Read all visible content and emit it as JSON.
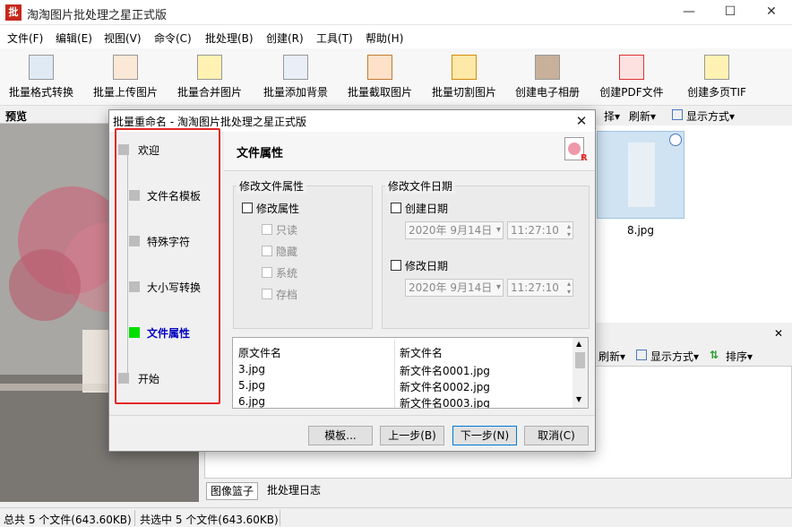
{
  "app": {
    "logo_text": "批",
    "title": "淘淘图片批处理之星正式版",
    "minimize": "—",
    "maximize": "☐",
    "close": "✕"
  },
  "menu": [
    "文件(F)",
    "编辑(E)",
    "视图(V)",
    "命令(C)",
    "批处理(B)",
    "创建(R)",
    "工具(T)",
    "帮助(H)"
  ],
  "toolbar": [
    {
      "label": "批量格式转换",
      "icon": "format-convert-icon"
    },
    {
      "label": "批量上传图片",
      "icon": "upload-icon"
    },
    {
      "label": "批量合并图片",
      "icon": "merge-icon"
    },
    {
      "label": "批量添加背景",
      "icon": "add-background-icon"
    },
    {
      "label": "批量截取图片",
      "icon": "crop-icon"
    },
    {
      "label": "批量切割图片",
      "icon": "split-icon"
    },
    {
      "label": "创建电子相册",
      "icon": "album-icon"
    },
    {
      "label": "创建PDF文件",
      "icon": "pdf-icon"
    },
    {
      "label": "创建多页TIF",
      "icon": "tif-icon"
    }
  ],
  "preview": {
    "label": "预览"
  },
  "right_toolbar": {
    "select_suffix": "择▾",
    "refresh": "刷新▾",
    "display": "显示方式▾"
  },
  "thumbnail": {
    "filename": "8.jpg"
  },
  "right_toolbar2": {
    "refresh": "刷新▾",
    "display": "显示方式▾",
    "sort": "排序▾"
  },
  "bottom_tabs": [
    "图像篮子",
    "批处理日志"
  ],
  "status": {
    "total": "总共 5 个文件(643.60KB)",
    "selected": "共选中 5 个文件(643.60KB)"
  },
  "dialog": {
    "title": "批量重命名 - 淘淘图片批处理之星正式版",
    "close": "✕",
    "steps": [
      "欢迎",
      "文件名模板",
      "特殊字符",
      "大小写转换",
      "文件属性",
      "开始"
    ],
    "active_step": 4,
    "content_title": "文件属性",
    "attr_group": {
      "title": "修改文件属性",
      "modify_label": "修改属性",
      "options": [
        "只读",
        "隐藏",
        "系统",
        "存档"
      ]
    },
    "date_group": {
      "title": "修改文件日期",
      "created_label": "创建日期",
      "created_date": "2020年  9月14日",
      "created_time": "11:27:10",
      "modified_label": "修改日期",
      "modified_date": "2020年  9月14日",
      "modified_time": "11:27:10"
    },
    "list": {
      "col_original": "原文件名",
      "col_new": "新文件名",
      "rows": [
        {
          "original": "3.jpg",
          "new": "新文件名0001.jpg"
        },
        {
          "original": "5.jpg",
          "new": "新文件名0002.jpg"
        },
        {
          "original": "6.jpg",
          "new": "新文件名0003.jpg"
        }
      ]
    },
    "buttons": {
      "template": "模板...",
      "prev": "上一步(B)",
      "next": "下一步(N)",
      "cancel": "取消(C)"
    },
    "highlight_color": "#e32727",
    "active_step_color": "#00e000"
  }
}
